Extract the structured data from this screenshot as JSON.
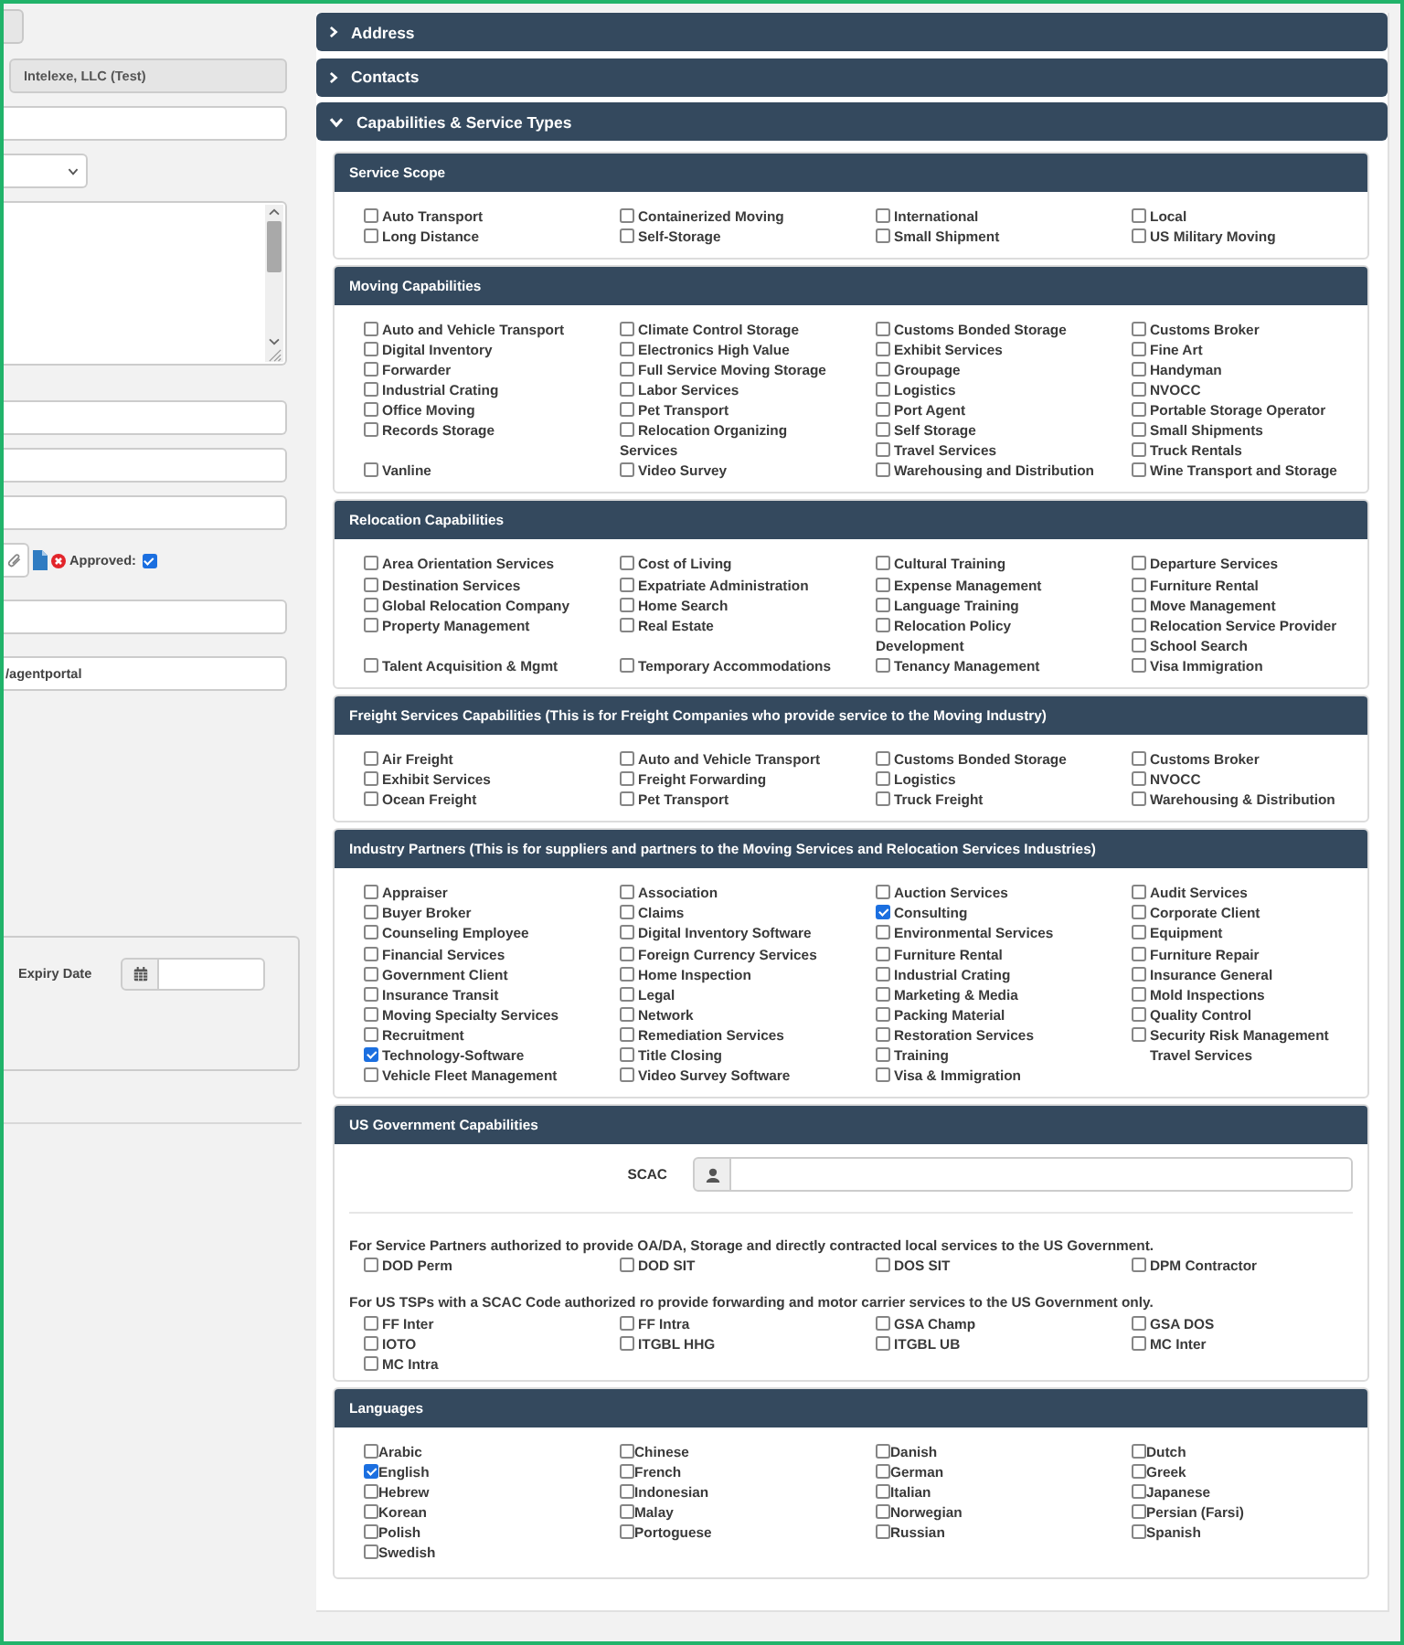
{
  "left_form": {
    "fields": [
      {
        "kind": "button"
      },
      {
        "kind": "text",
        "value": "Intelexe, LLC (Test)",
        "disabled": true
      },
      {
        "kind": "text",
        "disabled": false
      },
      {
        "kind": "select"
      },
      {
        "kind": "textarea"
      },
      {
        "kind": "text",
        "disabled": false
      },
      {
        "kind": "text",
        "disabled": false
      },
      {
        "kind": "text",
        "disabled": false
      },
      {
        "kind": "approval",
        "label": "Approved:",
        "checked": true
      },
      {
        "kind": "text",
        "disabled": false
      },
      {
        "kind": "text",
        "value": "/agentportal",
        "disabled": false
      },
      {
        "kind": "date",
        "label": "Expiry Date"
      }
    ]
  },
  "accordion": [
    {
      "title": "Address",
      "expanded": false
    },
    {
      "title": "Contacts",
      "expanded": false
    },
    {
      "title": "Capabilities & Service Types",
      "expanded": true,
      "sections": [
        {
          "title": "Service Scope",
          "kind": "checklist",
          "options": [
            {
              "label": "Auto Transport",
              "checked": false
            },
            {
              "label": "Containerized Moving",
              "checked": false
            },
            {
              "label": "International",
              "checked": false
            },
            {
              "label": "Local",
              "checked": false
            },
            {
              "label": "Long Distance",
              "checked": false
            },
            {
              "label": "Self-Storage",
              "checked": false
            },
            {
              "label": "Small Shipment",
              "checked": false
            },
            {
              "label": "US Military Moving",
              "checked": false
            }
          ]
        },
        {
          "title": "Moving Capabilities",
          "kind": "checklist",
          "options": [
            {
              "label": "Auto and Vehicle Transport",
              "checked": false
            },
            {
              "label": "Climate Control Storage",
              "checked": false
            },
            {
              "label": "Customs Bonded Storage",
              "checked": false
            },
            {
              "label": "Customs Broker",
              "checked": false
            },
            {
              "label": "Digital Inventory",
              "checked": false
            },
            {
              "label": "Electronics High Value",
              "checked": false
            },
            {
              "label": "Exhibit Services",
              "checked": false
            },
            {
              "label": "Fine Art",
              "checked": false
            },
            {
              "label": "Forwarder",
              "checked": false
            },
            {
              "label": "Full Service Moving Storage",
              "checked": false
            },
            {
              "label": "Groupage",
              "checked": false
            },
            {
              "label": "Handyman",
              "checked": false
            },
            {
              "label": "Industrial Crating",
              "checked": false
            },
            {
              "label": "Labor Services",
              "checked": false
            },
            {
              "label": "Logistics",
              "checked": false
            },
            {
              "label": "NVOCC",
              "checked": false
            },
            {
              "label": "Office Moving",
              "checked": false
            },
            {
              "label": "Pet Transport",
              "checked": false
            },
            {
              "label": "Port Agent",
              "checked": false
            },
            {
              "label": "Portable Storage Operator",
              "checked": false
            },
            {
              "label": "Records Storage",
              "checked": false
            },
            {
              "label": "Relocation Organizing Services",
              "checked": false
            },
            {
              "label": "Self Storage",
              "checked": false
            },
            {
              "label": "Small Shipments",
              "checked": false
            },
            {
              "label": "Travel Services",
              "checked": false
            },
            {
              "label": "Truck Rentals",
              "checked": false
            },
            {
              "label": "Vanline",
              "checked": false
            },
            {
              "label": "Video Survey",
              "checked": false
            },
            {
              "label": "Warehousing and Distribution",
              "checked": false
            },
            {
              "label": "Wine Transport and Storage",
              "checked": false
            }
          ]
        },
        {
          "title": "Relocation Capabilities",
          "kind": "checklist",
          "options": [
            {
              "label": "Area Orientation Services",
              "checked": false
            },
            {
              "label": "Cost of Living",
              "checked": false
            },
            {
              "label": "Cultural Training",
              "checked": false
            },
            {
              "label": "Departure Services",
              "checked": false
            },
            {
              "label": "Destination Services",
              "checked": false
            },
            {
              "label": "Expatriate Administration",
              "checked": false
            },
            {
              "label": "Expense Management",
              "checked": false
            },
            {
              "label": "Furniture Rental",
              "checked": false
            },
            {
              "label": "Global Relocation Company",
              "checked": false
            },
            {
              "label": "Home Search",
              "checked": false
            },
            {
              "label": "Language Training",
              "checked": false
            },
            {
              "label": "Move Management",
              "checked": false
            },
            {
              "label": "Property Management",
              "checked": false
            },
            {
              "label": "Real Estate",
              "checked": false
            },
            {
              "label": "Relocation Policy Development",
              "checked": false
            },
            {
              "label": "Relocation Service Provider",
              "checked": false
            },
            {
              "label": "School Search",
              "checked": false
            },
            {
              "label": "Talent Acquisition & Mgmt",
              "checked": false
            },
            {
              "label": "Temporary Accommodations",
              "checked": false
            },
            {
              "label": "Tenancy Management",
              "checked": false
            },
            {
              "label": "Visa Immigration",
              "checked": false
            }
          ]
        },
        {
          "title": "Freight Services Capabilities (This is for Freight Companies who provide service to the Moving Industry)",
          "kind": "checklist",
          "options": [
            {
              "label": "Air Freight",
              "checked": false
            },
            {
              "label": "Auto and Vehicle Transport",
              "checked": false
            },
            {
              "label": "Customs Bonded Storage",
              "checked": false
            },
            {
              "label": "Customs Broker",
              "checked": false
            },
            {
              "label": "Exhibit Services",
              "checked": false
            },
            {
              "label": "Freight Forwarding",
              "checked": false
            },
            {
              "label": "Logistics",
              "checked": false
            },
            {
              "label": "NVOCC",
              "checked": false
            },
            {
              "label": "Ocean Freight",
              "checked": false
            },
            {
              "label": "Pet Transport",
              "checked": false
            },
            {
              "label": "Truck Freight",
              "checked": false
            },
            {
              "label": "Warehousing & Distribution",
              "checked": false
            }
          ]
        },
        {
          "title": "Industry Partners (This is for suppliers and partners to the Moving Services and Relocation Services Industries)",
          "kind": "checklist",
          "options": [
            {
              "kind": "checkbox",
              "label": "Appraiser",
              "checked": false
            },
            {
              "kind": "checkbox",
              "label": "Association",
              "checked": false
            },
            {
              "kind": "checkbox",
              "label": "Auction Services",
              "checked": false
            },
            {
              "kind": "checkbox",
              "label": "Audit Services",
              "checked": false
            },
            {
              "kind": "checkbox",
              "label": "Buyer Broker",
              "checked": false
            },
            {
              "kind": "checkbox",
              "label": "Claims",
              "checked": false
            },
            {
              "kind": "checkbox",
              "label": "Consulting",
              "checked": true
            },
            {
              "kind": "checkbox",
              "label": "Corporate Client",
              "checked": false
            },
            {
              "kind": "checkbox",
              "label": "Counseling Employee",
              "checked": false
            },
            {
              "kind": "checkbox",
              "label": "Digital Inventory Software",
              "checked": false
            },
            {
              "kind": "checkbox",
              "label": "Environmental Services",
              "checked": false
            },
            {
              "kind": "checkbox",
              "label": "Equipment",
              "checked": false
            },
            {
              "kind": "checkbox",
              "label": "Financial Services",
              "checked": false
            },
            {
              "kind": "checkbox",
              "label": "Foreign Currency Services",
              "checked": false
            },
            {
              "kind": "checkbox",
              "label": "Furniture Rental",
              "checked": false
            },
            {
              "kind": "checkbox",
              "label": "Furniture Repair",
              "checked": false
            },
            {
              "kind": "checkbox",
              "label": "Government Client",
              "checked": false
            },
            {
              "kind": "checkbox",
              "label": "Home Inspection",
              "checked": false
            },
            {
              "kind": "checkbox",
              "label": "Industrial Crating",
              "checked": false
            },
            {
              "kind": "checkbox",
              "label": "Insurance General",
              "checked": false
            },
            {
              "kind": "checkbox",
              "label": "Insurance Transit",
              "checked": false
            },
            {
              "kind": "checkbox",
              "label": "Legal",
              "checked": false
            },
            {
              "kind": "checkbox",
              "label": "Marketing & Media",
              "checked": false
            },
            {
              "kind": "checkbox",
              "label": "Mold Inspections",
              "checked": false
            },
            {
              "kind": "checkbox",
              "label": "Moving Specialty Services",
              "checked": false
            },
            {
              "kind": "checkbox",
              "label": "Network",
              "checked": false
            },
            {
              "kind": "checkbox",
              "label": "Packing Material",
              "checked": false
            },
            {
              "kind": "checkbox",
              "label": "Quality Control",
              "checked": false
            },
            {
              "kind": "checkbox",
              "label": "Recruitment",
              "checked": false
            },
            {
              "kind": "checkbox",
              "label": "Remediation Services",
              "checked": false
            },
            {
              "kind": "checkbox",
              "label": "Restoration Services",
              "checked": false
            },
            {
              "kind": "checkbox",
              "label": "Security Risk Management",
              "checked": false
            },
            {
              "kind": "checkbox",
              "label": "Technology-Software",
              "checked": true
            },
            {
              "kind": "checkbox",
              "label": "Title Closing",
              "checked": false
            },
            {
              "kind": "checkbox",
              "label": "Training",
              "checked": false
            },
            {
              "kind": "plain",
              "label": "Travel Services"
            },
            {
              "kind": "checkbox",
              "label": "Vehicle Fleet Management",
              "checked": false
            },
            {
              "kind": "checkbox",
              "label": "Video Survey Software",
              "checked": false
            },
            {
              "kind": "checkbox",
              "label": "Visa & Immigration",
              "checked": false
            }
          ]
        },
        {
          "title": "US Government Capabilities",
          "kind": "government",
          "scac": {
            "label": "SCAC"
          },
          "groups": [
            {
              "note": "For Service Partners authorized to provide OA/DA, Storage and directly contracted local services to the US Government.",
              "options": [
                {
                  "label": "DOD Perm",
                  "checked": false
                },
                {
                  "label": "DOD SIT",
                  "checked": false
                },
                {
                  "label": "DOS SIT",
                  "checked": false
                },
                {
                  "label": "DPM Contractor",
                  "checked": false
                }
              ]
            },
            {
              "note": "For US TSPs with a SCAC Code authorized ro provide forwarding and motor carrier services to the US Government only.",
              "options": [
                {
                  "label": "FF Inter",
                  "checked": false
                },
                {
                  "label": "FF Intra",
                  "checked": false
                },
                {
                  "label": "GSA Champ",
                  "checked": false
                },
                {
                  "label": "GSA DOS",
                  "checked": false
                },
                {
                  "label": "IOTO",
                  "checked": false
                },
                {
                  "label": "ITGBL HHG",
                  "checked": false
                },
                {
                  "label": "ITGBL UB",
                  "checked": false
                },
                {
                  "label": "MC Inter",
                  "checked": false
                },
                {
                  "label": "MC Intra",
                  "checked": false
                }
              ]
            }
          ]
        },
        {
          "title": "Languages",
          "kind": "languages",
          "options": [
            {
              "label": "Arabic",
              "checked": false
            },
            {
              "label": "Chinese",
              "checked": false
            },
            {
              "label": "Danish",
              "checked": false
            },
            {
              "label": "Dutch",
              "checked": false
            },
            {
              "label": "English",
              "checked": true
            },
            {
              "label": "French",
              "checked": false
            },
            {
              "label": "German",
              "checked": false
            },
            {
              "label": "Greek",
              "checked": false
            },
            {
              "label": "Hebrew",
              "checked": false
            },
            {
              "label": "Indonesian",
              "checked": false
            },
            {
              "label": "Italian",
              "checked": false
            },
            {
              "label": "Japanese",
              "checked": false
            },
            {
              "label": "Korean",
              "checked": false
            },
            {
              "label": "Malay",
              "checked": false
            },
            {
              "label": "Norwegian",
              "checked": false
            },
            {
              "label": "Persian (Farsi)",
              "checked": false
            },
            {
              "label": "Polish",
              "checked": false
            },
            {
              "label": "Portoguese",
              "checked": false
            },
            {
              "label": "Russian",
              "checked": false
            },
            {
              "label": "Spanish",
              "checked": false
            },
            {
              "label": "Swedish",
              "checked": false
            }
          ]
        }
      ]
    }
  ]
}
